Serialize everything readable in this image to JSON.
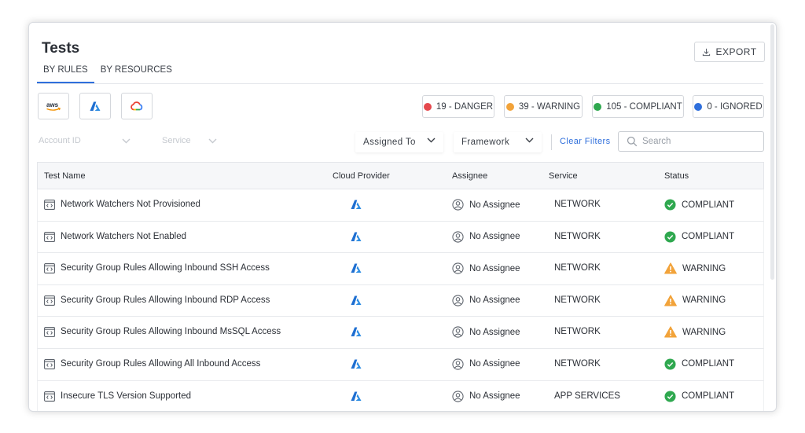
{
  "page": {
    "title": "Tests",
    "export_label": "EXPORT"
  },
  "tabs": [
    {
      "label": "BY RULES",
      "active": true
    },
    {
      "label": "BY RESOURCES",
      "active": false
    }
  ],
  "providers": [
    {
      "name": "aws",
      "icon": "aws-logo-icon"
    },
    {
      "name": "azure",
      "icon": "azure-logo-icon"
    },
    {
      "name": "gcp",
      "icon": "google-cloud-logo-icon"
    }
  ],
  "summary": [
    {
      "label": "19 - DANGER",
      "color": "#e5484d"
    },
    {
      "label": "39 - WARNING",
      "color": "#f2a33a"
    },
    {
      "label": "105 - COMPLIANT",
      "color": "#2fa84f"
    },
    {
      "label": "0 - IGNORED",
      "color": "#2f6fdc"
    }
  ],
  "filters": {
    "account_id": "Account ID",
    "service": "Service",
    "assigned_to": "Assigned To",
    "framework": "Framework",
    "clear": "Clear Filters",
    "search_placeholder": "Search"
  },
  "columns": {
    "test_name": "Test Name",
    "cloud_provider": "Cloud Provider",
    "assignee": "Assignee",
    "service": "Service",
    "status": "Status"
  },
  "status_colors": {
    "compliant": "#2fa84f",
    "warning": "#f2a33a"
  },
  "rows": [
    {
      "name": "Network Watchers Not Provisioned",
      "provider": "azure-logo-icon",
      "assignee": "No Assignee",
      "service": "NETWORK",
      "status": "COMPLIANT"
    },
    {
      "name": "Network Watchers Not Enabled",
      "provider": "azure-logo-icon",
      "assignee": "No Assignee",
      "service": "NETWORK",
      "status": "COMPLIANT"
    },
    {
      "name": "Security Group Rules Allowing Inbound SSH Access",
      "provider": "azure-logo-icon",
      "assignee": "No Assignee",
      "service": "NETWORK",
      "status": "WARNING"
    },
    {
      "name": "Security Group Rules Allowing Inbound RDP Access",
      "provider": "azure-logo-icon",
      "assignee": "No Assignee",
      "service": "NETWORK",
      "status": "WARNING"
    },
    {
      "name": "Security Group Rules Allowing Inbound MsSQL Access",
      "provider": "azure-logo-icon",
      "assignee": "No Assignee",
      "service": "NETWORK",
      "status": "WARNING"
    },
    {
      "name": "Security Group Rules Allowing All Inbound Access",
      "provider": "azure-logo-icon",
      "assignee": "No Assignee",
      "service": "NETWORK",
      "status": "COMPLIANT"
    },
    {
      "name": "Insecure TLS Version Supported",
      "provider": "azure-logo-icon",
      "assignee": "No Assignee",
      "service": "APP SERVICES",
      "status": "COMPLIANT"
    }
  ]
}
